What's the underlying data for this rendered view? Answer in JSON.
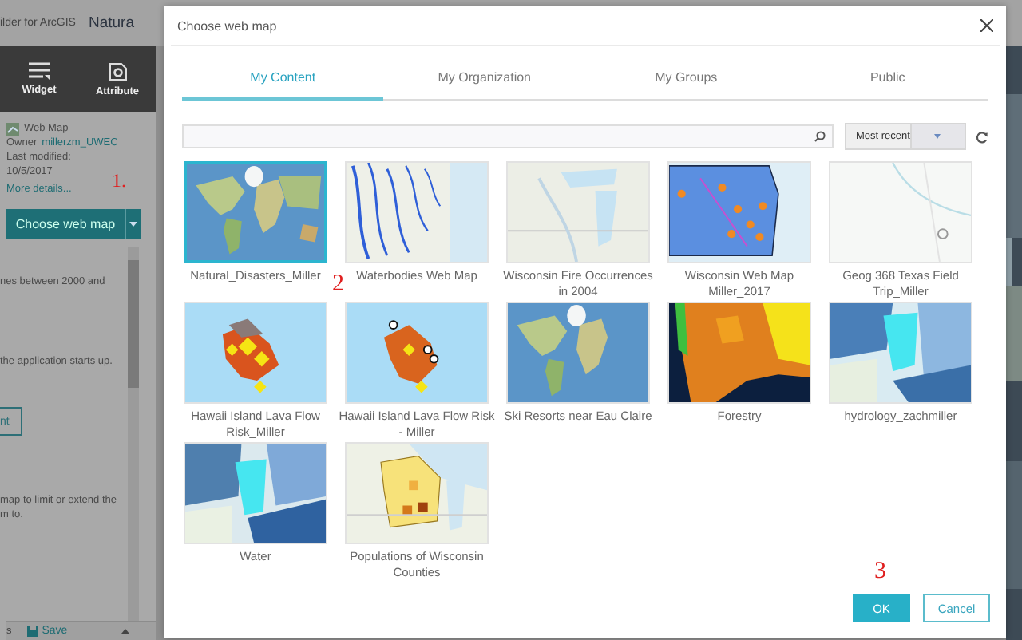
{
  "app": {
    "header_title": "ilder for ArcGIS",
    "app_name": "Natura",
    "toolbar": [
      {
        "label": "Widget"
      },
      {
        "label": "Attribute"
      }
    ],
    "web_map": {
      "heading": "Web Map",
      "owner_label": "Owner",
      "owner": "millerzm_UWEC",
      "modified_label": "Last modified:",
      "modified": "10/5/2017",
      "more_link": "More details...",
      "choose_button": "Choose web map",
      "annotation": "1."
    },
    "text_1": "nes between 2000 and",
    "text_2": "the application starts up.",
    "partial_button": "nt",
    "text_3": "map to limit or extend the",
    "text_4": "m to.",
    "footer": {
      "left": "s",
      "save": "Save"
    }
  },
  "dialog": {
    "title": "Choose web map",
    "tabs": [
      {
        "label": "My Content",
        "selected": true
      },
      {
        "label": "My Organization",
        "selected": false
      },
      {
        "label": "My Groups",
        "selected": false
      },
      {
        "label": "Public",
        "selected": false
      }
    ],
    "sort": "Most recent",
    "maps": [
      {
        "title": "Natural_Disasters_Miller",
        "selected": true,
        "annotation": "2"
      },
      {
        "title": "Waterbodies Web Map",
        "selected": false
      },
      {
        "title": "Wisconsin Fire Occurrences in 2004",
        "selected": false
      },
      {
        "title": "Wisconsin Web Map Miller_2017",
        "selected": false
      },
      {
        "title": "Geog 368 Texas Field Trip_Miller",
        "selected": false
      },
      {
        "title": "Hawaii Island Lava Flow Risk_Miller",
        "selected": false
      },
      {
        "title": "Hawaii Island Lava Flow Risk - Miller",
        "selected": false
      },
      {
        "title": "Ski Resorts near Eau Claire",
        "selected": false
      },
      {
        "title": "Forestry",
        "selected": false
      },
      {
        "title": "hydrology_zachmiller",
        "selected": false
      },
      {
        "title": "Water",
        "selected": false
      },
      {
        "title": "Populations of Wisconsin Counties",
        "selected": false
      }
    ],
    "ok": "OK",
    "cancel": "Cancel",
    "ok_annotation": "3"
  }
}
